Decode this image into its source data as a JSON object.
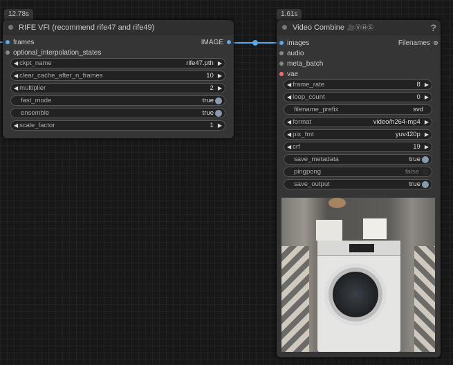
{
  "rife": {
    "time": "12.78s",
    "title": "RIFE VFI (recommend rife47 and rife49)",
    "inputs": [
      "frames",
      "optional_interpolation_states"
    ],
    "output": "IMAGE",
    "widgets": [
      {
        "label": "ckpt_name",
        "value": "rife47.pth",
        "type": "combo"
      },
      {
        "label": "clear_cache_after_n_frames",
        "value": "10",
        "type": "number"
      },
      {
        "label": "multiplier",
        "value": "2",
        "type": "number"
      },
      {
        "label": "fast_mode",
        "value": "true",
        "type": "toggle"
      },
      {
        "label": "ensemble",
        "value": "true",
        "type": "toggle"
      },
      {
        "label": "scale_factor",
        "value": "1",
        "type": "number"
      }
    ]
  },
  "vc": {
    "time": "1.61s",
    "title": "Video Combine",
    "badge_icons": "🎥ⓋⒽⓈ",
    "help": "?",
    "inputs": [
      "images",
      "audio",
      "meta_batch",
      "vae"
    ],
    "output": "Filenames",
    "widgets": [
      {
        "label": "frame_rate",
        "value": "8",
        "type": "number"
      },
      {
        "label": "loop_count",
        "value": "0",
        "type": "number"
      },
      {
        "label": "filename_prefix",
        "value": "svd",
        "type": "text"
      },
      {
        "label": "format",
        "value": "video/h264-mp4",
        "type": "combo"
      },
      {
        "label": "pix_fmt",
        "value": "yuv420p",
        "type": "combo"
      },
      {
        "label": "crf",
        "value": "19",
        "type": "number"
      },
      {
        "label": "save_metadata",
        "value": "true",
        "type": "toggle"
      },
      {
        "label": "pingpong",
        "value": "false",
        "type": "toggle"
      },
      {
        "label": "save_output",
        "value": "true",
        "type": "toggle"
      }
    ]
  },
  "colors": {
    "link": "#5aa9e6",
    "image_slot": "#5aa9e6",
    "vae_slot": "#ff6e6e"
  }
}
